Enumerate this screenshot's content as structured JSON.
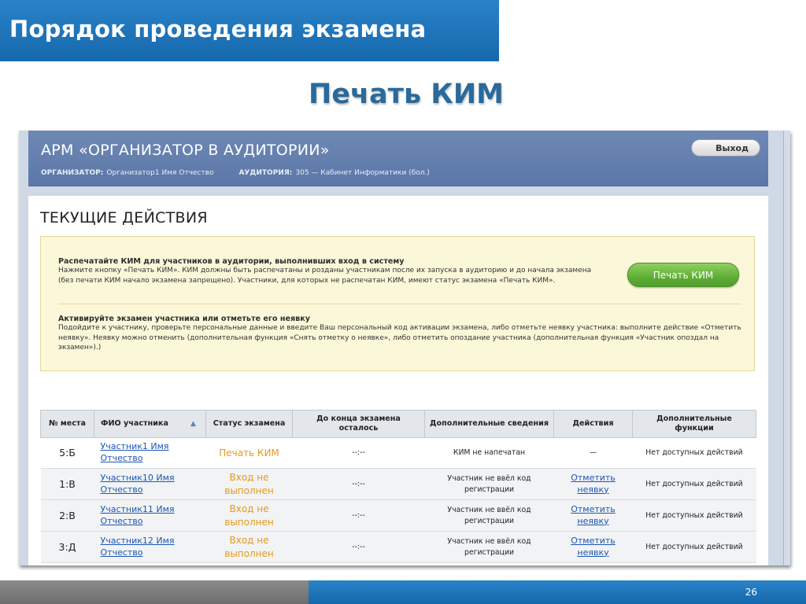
{
  "slide": {
    "title": "Порядок проведения экзамена",
    "subtitle": "Печать КИМ",
    "page_number": "26"
  },
  "app": {
    "title": "АРМ «ОРГАНИЗАТОР В АУДИТОРИИ»",
    "organizer_label": "ОРГАНИЗАТОР:",
    "organizer_value": "Организатор1 Имя Отчество",
    "room_label": "АУДИТОРИЯ:",
    "room_value": "305 — Кабинет Информатики (бол.)",
    "logout_label": "Выход"
  },
  "current_actions": {
    "title": "ТЕКУЩИЕ ДЕЙСТВИЯ",
    "block1": {
      "heading": "Распечатайте КИМ для участников в аудитории, выполнивших вход в систему",
      "text": "Нажмите кнопку «Печать КИМ». КИМ должны быть распечатаны и розданы участникам после их запуска в аудиторию и до начала экзамена (без печати КИМ начало экзамена запрещено). Участники, для которых не распечатан КИМ, имеют статус экзамена «Печать КИМ».",
      "button_label": "Печать КИМ"
    },
    "block2": {
      "heading": "Активируйте экзамен участника или отметьте его неявку",
      "text": "Подойдите к участнику, проверьте персональные данные и введите Ваш персональный код активации экзамена, либо отметьте неявку участника: выполните действие «Отметить неявку». Неявку можно отменить (дополнительная функция «Снять отметку о неявке», либо отметить опоздание участника (дополнительная функция «Участник опоздал на экзамен»).)"
    }
  },
  "table": {
    "headers": {
      "place": "№ места",
      "name": "ФИО участника",
      "status": "Статус экзамена",
      "remaining": "До конца экзамена осталось",
      "info": "Дополнительные сведения",
      "actions": "Действия",
      "extra": "Дополнительные функции"
    },
    "rows": [
      {
        "place": "5:Б",
        "name": "Участник1 Имя Отчество",
        "status": "Печать КИМ",
        "remaining": "--:--",
        "info": "КИМ не напечатан",
        "action": "—",
        "extra": "Нет доступных действий"
      },
      {
        "place": "1:В",
        "name": "Участник10 Имя Отчество",
        "status": "Вход не выполнен",
        "remaining": "--:--",
        "info": "Участник не ввёл код регистрации",
        "action": "Отметить неявку",
        "extra": "Нет доступных действий"
      },
      {
        "place": "2:В",
        "name": "Участник11 Имя Отчество",
        "status": "Вход не выполнен",
        "remaining": "--:--",
        "info": "Участник не ввёл код регистрации",
        "action": "Отметить неявку",
        "extra": "Нет доступных действий"
      },
      {
        "place": "3:Д",
        "name": "Участник12 Имя Отчество",
        "status": "Вход не выполнен",
        "remaining": "--:--",
        "info": "Участник не ввёл код регистрации",
        "action": "Отметить неявку",
        "extra": "Нет доступных действий"
      }
    ]
  },
  "colors": {
    "title_bar": "#1a6fb4",
    "app_header": "#6580b0",
    "print_button": "#5fae36",
    "status_text": "#e49a1c",
    "link": "#1c56b3",
    "instruction_bg": "#fbf7d9"
  }
}
